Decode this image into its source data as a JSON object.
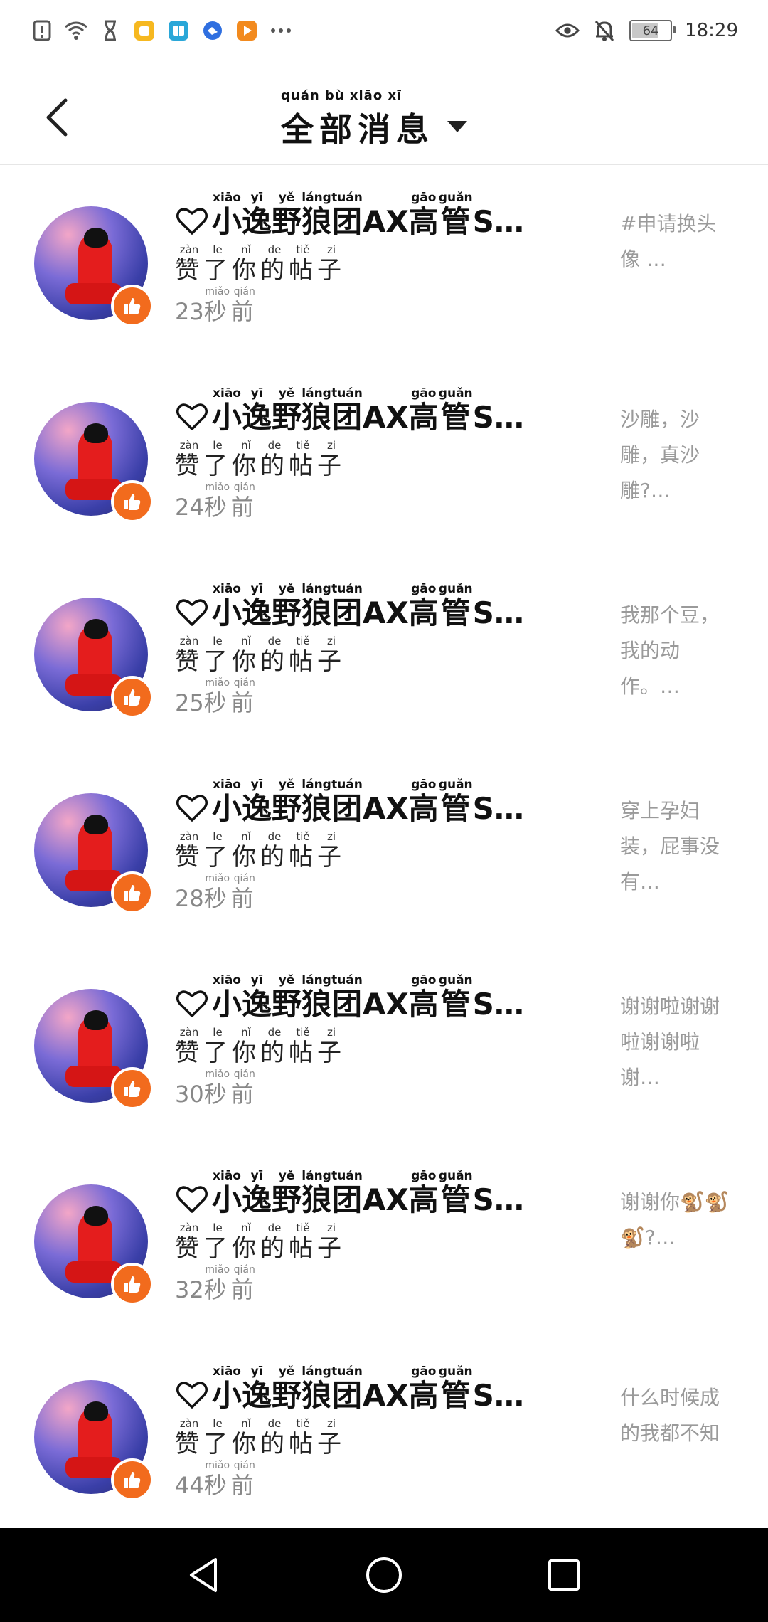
{
  "status_bar": {
    "time": "18:29",
    "battery": "64",
    "battery_level": 0.64,
    "left_icons": [
      "alert-icon",
      "wifi-icon",
      "hourglass-icon",
      "app-yellow-icon",
      "app-book-icon",
      "app-blue-icon",
      "app-orange-play-icon",
      "more-dots-icon"
    ],
    "right_icons": [
      "eye-icon",
      "mute-bell-icon"
    ]
  },
  "header": {
    "title_pinyin": "quán bù xiāo xī",
    "title": "全部消息"
  },
  "colors": {
    "like_badge": "#f26b1d",
    "divider": "#e6e6e6",
    "secondary_text": "#888888",
    "preview_text": "#9a9a9a"
  },
  "username": {
    "pinyin": [
      "",
      "xiāo",
      "yī",
      "yě",
      "láng",
      "tuán",
      "",
      "",
      "gāo",
      "guǎn",
      ""
    ],
    "chars": [
      "",
      "小",
      "逸",
      "野",
      "狼",
      "团",
      "A",
      "X",
      "高",
      "管",
      "S…"
    ]
  },
  "action": {
    "pinyin": [
      "zàn",
      "le",
      "nǐ",
      "de",
      "tiě",
      "zi"
    ],
    "chars": [
      "赞",
      "了",
      "你",
      "的",
      "帖",
      "子"
    ]
  },
  "time_suffix": {
    "pinyin": [
      "miǎo",
      "qián"
    ],
    "chars": [
      "秒",
      "前"
    ]
  },
  "notifications": [
    {
      "seconds": "23",
      "preview": "#申请换头像 …"
    },
    {
      "seconds": "24",
      "preview": "沙雕，沙雕，真沙雕?…"
    },
    {
      "seconds": "25",
      "preview": "我那个豆，我的动作。…"
    },
    {
      "seconds": "28",
      "preview": "穿上孕妇装，屁事没有…"
    },
    {
      "seconds": "30",
      "preview": "谢谢啦谢谢啦谢谢啦谢…"
    },
    {
      "seconds": "32",
      "preview": "谢谢你🐒🐒🐒?…"
    },
    {
      "seconds": "44",
      "preview": "什么时候成的我都不知"
    }
  ],
  "nav_bar": [
    "back-triangle-icon",
    "home-circle-icon",
    "recent-square-icon"
  ]
}
